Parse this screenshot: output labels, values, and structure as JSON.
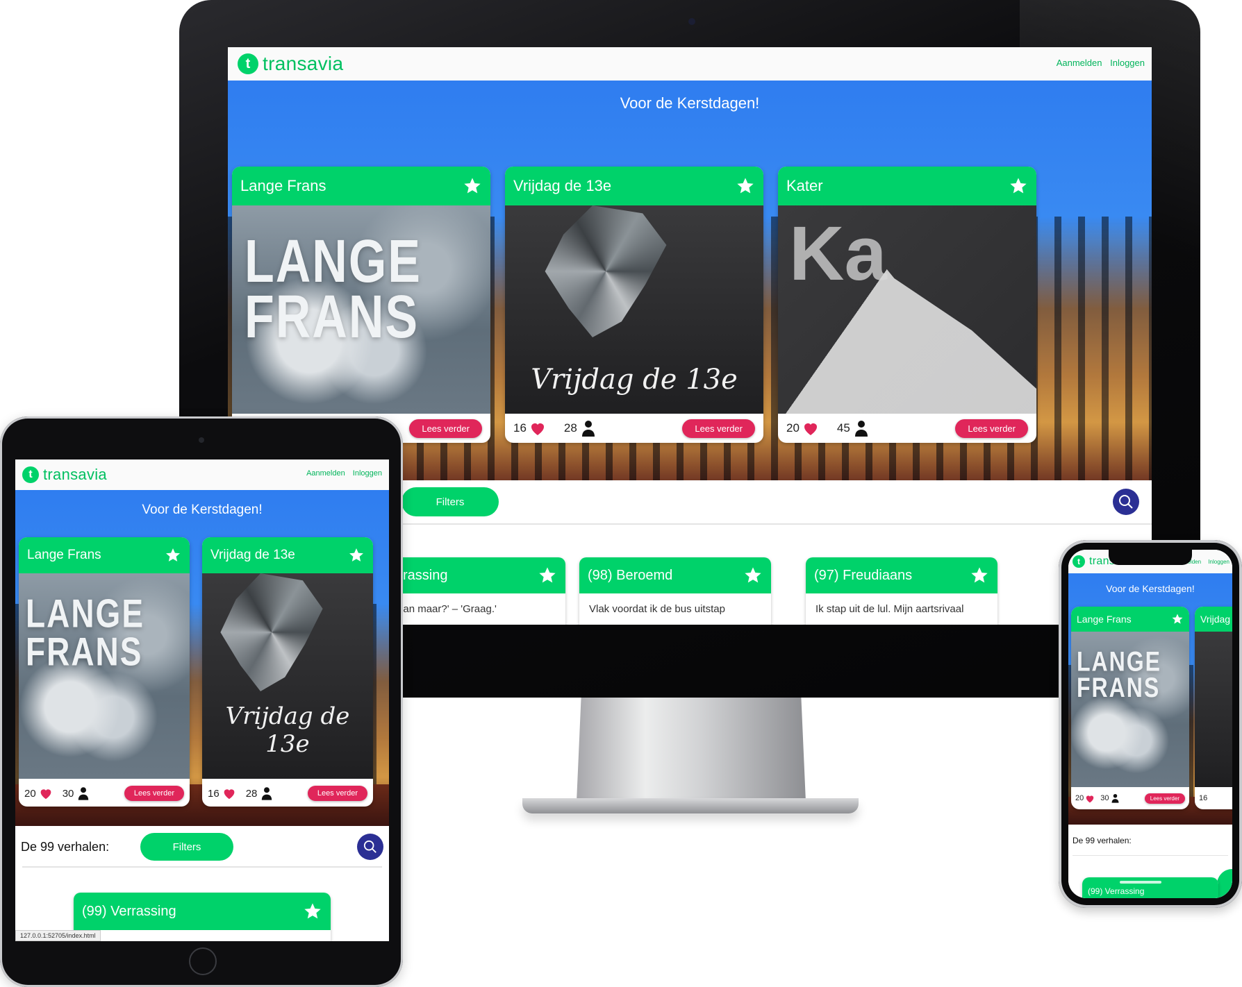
{
  "app": {
    "brand": "transavia",
    "logo_letter": "t",
    "nav": {
      "register": "Aanmelden",
      "login": "Inloggen"
    },
    "hero_title": "Voor de Kerstdagen!",
    "featured": [
      {
        "title": "Lange Frans",
        "image_text": "LANGE FRANS",
        "likes": "20",
        "readers": "30",
        "cta": "Lees verder"
      },
      {
        "title": "Vrijdag de 13e",
        "image_text": "Vrijdag de 13e",
        "likes": "16",
        "readers": "28",
        "cta": "Lees verder"
      },
      {
        "title": "Kater",
        "image_text": "Ka",
        "likes": "20",
        "readers": "45",
        "cta": "Lees verder"
      }
    ],
    "stories_heading": "De 99 verhalen:",
    "filters_label": "Filters",
    "stories": [
      {
        "title": "(99) Verrassing",
        "monitor_title": "Verrassing",
        "snippet": "tie dan maar?' – 'Graag.'"
      },
      {
        "title": "(98) Beroemd",
        "snippet": "Vlak voordat ik de bus uitstap"
      },
      {
        "title": "(97) Freudiaans",
        "snippet": "Ik stap uit de lul. Mijn aartsrivaal"
      }
    ],
    "status_url": "127.0.0.1:52705/index.html",
    "phone_story_partial": "(99) Verrassing"
  },
  "colors": {
    "green": "#00d26a",
    "pink": "#e0265a",
    "navy": "#2b2f94",
    "sky": "#3b8cf2"
  },
  "icons": [
    "star-icon",
    "heart-icon",
    "person-icon",
    "search-icon",
    "transavia-logo-icon"
  ]
}
